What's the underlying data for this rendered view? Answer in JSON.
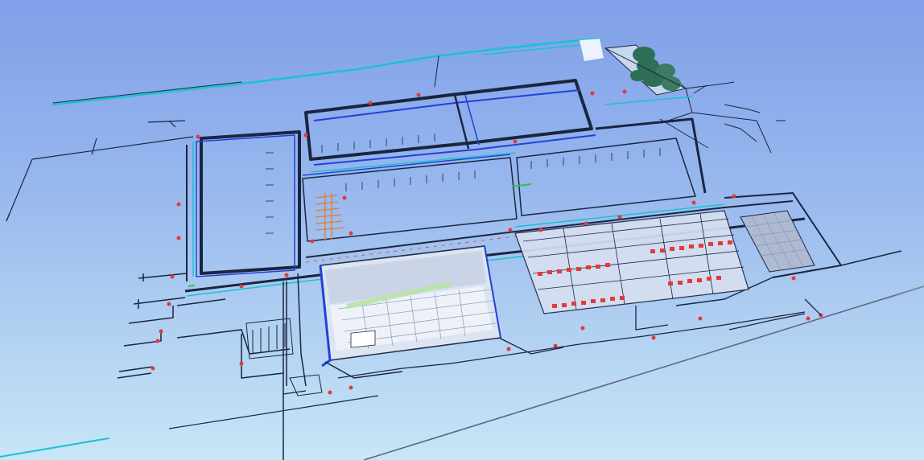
{
  "scene": {
    "view": "3d-perspective",
    "subject": "mep-piping-model",
    "has_text_labels": false
  },
  "colors": {
    "sky_top": "#7f9fe9",
    "sky_bottom": "#c8e6f6",
    "pipe_dark": "#1b2540",
    "pipe_blue": "#2340d8",
    "pipe_cyan": "#19c3cf",
    "pipe_red": "#e23a3a",
    "pipe_orange": "#d9844a",
    "pipe_green": "#32c142",
    "pipe_magenta": "#c02bd6",
    "glass_panel": "#dfe6f1",
    "tank_green": "#2d6e56"
  },
  "icons": [
    "storage-tank-icon",
    "cooling-tower-icon",
    "pipe-rack-icon"
  ]
}
